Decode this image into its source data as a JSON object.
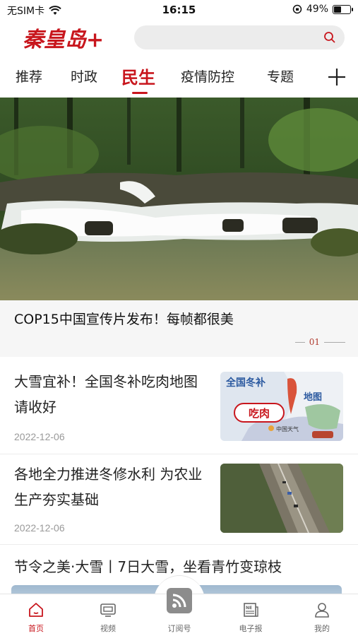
{
  "status_bar": {
    "carrier": "无SIM卡",
    "time": "16:15",
    "battery_percent": "49%",
    "battery_level": 0.49
  },
  "header": {
    "logo_text": "秦皇岛+",
    "search_placeholder": ""
  },
  "tabs": [
    {
      "label": "推荐",
      "active": false
    },
    {
      "label": "时政",
      "active": false
    },
    {
      "label": "民生",
      "active": true
    },
    {
      "label": "疫情防控",
      "active": false
    },
    {
      "label": "专题",
      "active": false
    }
  ],
  "hero": {
    "title": "COP15中国宣传片发布！每帧都很美",
    "page_indicator": "01"
  },
  "news": [
    {
      "title": "大雪宜补！全国冬补吃肉地图请收好",
      "date": "2022-12-06",
      "thumb": {
        "heading_left": "全国冬补",
        "heading_right": "地图",
        "center_word": "吃肉",
        "source": "中国天气"
      }
    },
    {
      "title": "各地全力推进冬修水利 为农业生产夯实基础",
      "date": "2022-12-06"
    }
  ],
  "news_wide": {
    "title": "节令之美·大雪丨7日大雪，坐看青竹变琼枝"
  },
  "bottom_nav": [
    {
      "label": "首页",
      "icon": "home-icon",
      "active": true
    },
    {
      "label": "视频",
      "icon": "video-icon",
      "active": false
    },
    {
      "label": "订阅号",
      "icon": "rss-icon",
      "active": false
    },
    {
      "label": "电子报",
      "icon": "newspaper-icon",
      "active": false
    },
    {
      "label": "我的",
      "icon": "user-icon",
      "active": false
    }
  ],
  "colors": {
    "brand_red": "#c8161d",
    "date_gray": "#999999"
  }
}
